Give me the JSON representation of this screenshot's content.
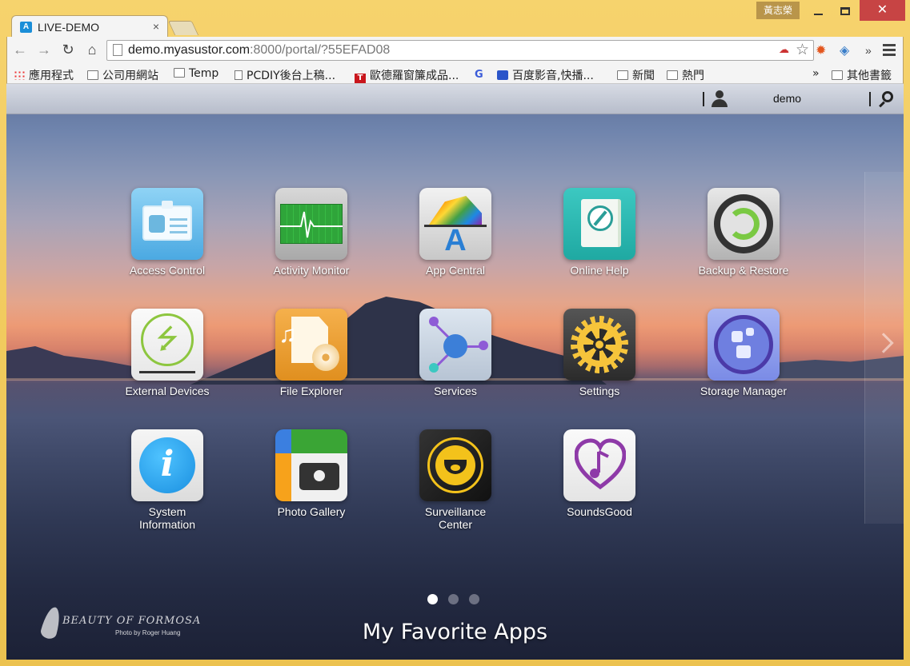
{
  "window": {
    "user_badge": "黃志榮",
    "minimize_glyph": "—",
    "close_glyph": "✕"
  },
  "tab": {
    "title": "LIVE-DEMO",
    "favicon_letter": "A",
    "close_glyph": "×"
  },
  "toolbar": {
    "back_glyph": "←",
    "forward_glyph": "→",
    "reload_glyph": "↻",
    "home_glyph": "⌂",
    "url_host": "demo.myasustor.com",
    "url_rest": ":8000/portal/?55EFAD08",
    "star_glyph": "☆",
    "more_glyph": "»"
  },
  "bookmarks": {
    "items": [
      {
        "label": "應用程式",
        "icon": "apps-icon"
      },
      {
        "label": "公司用網站",
        "icon": "folder-icon"
      },
      {
        "label": "Temp",
        "icon": "folder-icon"
      },
      {
        "label": "PCDIY後台上稿...",
        "icon": "page-icon"
      },
      {
        "label": "歐德羅窗簾成品...",
        "icon": "t-icon"
      },
      {
        "label": "G",
        "icon": "g-icon"
      },
      {
        "label": "百度影音,快播...",
        "icon": "paw-icon"
      },
      {
        "label": "新聞",
        "icon": "folder-icon"
      },
      {
        "label": "熱門",
        "icon": "folder-icon"
      }
    ],
    "overflow": "»",
    "other": "其他書籤"
  },
  "portal": {
    "username": "demo",
    "apps": [
      {
        "label": "Access Control",
        "icon": "access-control-icon"
      },
      {
        "label": "Activity Monitor",
        "icon": "activity-monitor-icon"
      },
      {
        "label": "App Central",
        "icon": "app-central-icon"
      },
      {
        "label": "Online Help",
        "icon": "online-help-icon"
      },
      {
        "label": "Backup & Restore",
        "icon": "backup-restore-icon"
      },
      {
        "label": "External Devices",
        "icon": "external-devices-icon"
      },
      {
        "label": "File Explorer",
        "icon": "file-explorer-icon"
      },
      {
        "label": "Services",
        "icon": "services-icon"
      },
      {
        "label": "Settings",
        "icon": "settings-icon"
      },
      {
        "label": "Storage Manager",
        "icon": "storage-manager-icon"
      },
      {
        "label": "System Information",
        "icon": "system-information-icon"
      },
      {
        "label": "Photo Gallery",
        "icon": "photo-gallery-icon"
      },
      {
        "label": "Surveillance Center",
        "icon": "surveillance-center-icon"
      },
      {
        "label": "SoundsGood",
        "icon": "soundsgood-icon"
      }
    ],
    "pager": {
      "pages": 3,
      "current": 1
    },
    "caption": "My Favorite Apps",
    "watermark_title": "BEAUTY OF FORMOSA",
    "watermark_credit": "Photo by Roger Huang"
  }
}
